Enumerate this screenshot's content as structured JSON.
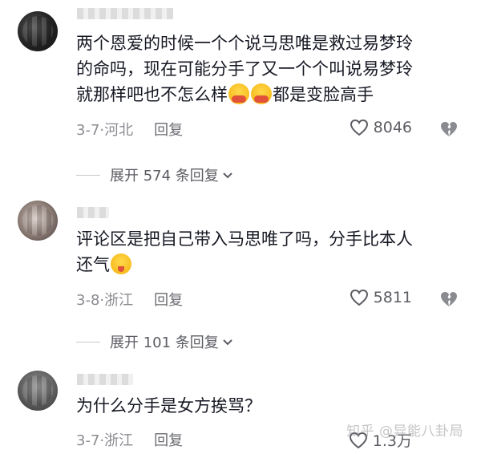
{
  "comments": [
    {
      "text_parts": [
        "两个恩爱的时候一个个说马思唯是救过易梦玲\n的命吗，现在可能分手了又一个个叫说易梦玲\n就那样吧也不怎么样",
        "都是变脸高手"
      ],
      "date": "3-7",
      "location": "河北",
      "reply_label": "回复",
      "likes": "8046",
      "expand_label": "展开 574 条回复"
    },
    {
      "text_parts": [
        "评论区是把自己带入马思唯了吗，分手比本人\n还气",
        ""
      ],
      "date": "3-8",
      "location": "浙江",
      "reply_label": "回复",
      "likes": "5811",
      "expand_label": "展开 101 条回复"
    },
    {
      "text_parts": [
        "为什么分手是女方挨骂？",
        ""
      ],
      "date": "3-7",
      "location": "浙江",
      "reply_label": "回复",
      "likes": "1.3万"
    }
  ],
  "watermark": "知乎 @异能八卦局",
  "icons": {
    "like": "heart-icon",
    "dislike": "broken-heart-icon",
    "expand": "chevron-down-icon"
  },
  "colors": {
    "text": "#161823",
    "meta": "#8a8b91",
    "secondary": "#5c5d63"
  }
}
